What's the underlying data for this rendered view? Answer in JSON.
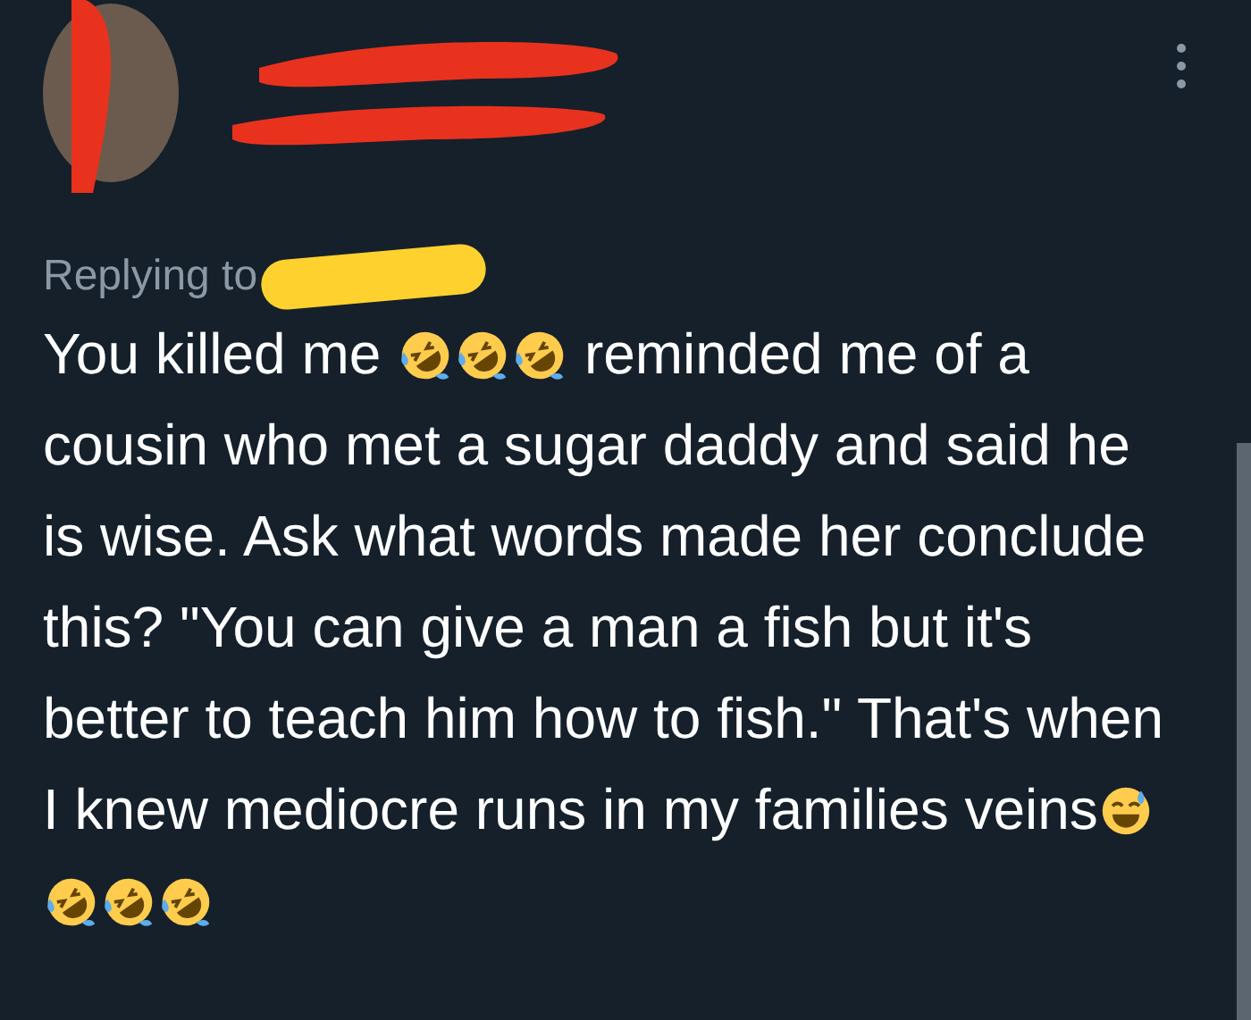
{
  "reply": {
    "label": "Replying to"
  },
  "body": {
    "lead": "You killed me",
    "lead_emojis": [
      {
        "kind": "rofl"
      },
      {
        "kind": "rofl"
      },
      {
        "kind": "rofl"
      }
    ],
    "text": "reminded me of a cousin who met a sugar daddy and said he is wise.  Ask what words made her conclude this? \"You can give a man a fish but it's better to teach him how to fish.\" That's when I knew mediocre runs in my families veins",
    "tail_emojis": [
      {
        "kind": "sweat-smile"
      },
      {
        "kind": "rofl"
      },
      {
        "kind": "rofl"
      },
      {
        "kind": "rofl"
      }
    ]
  }
}
